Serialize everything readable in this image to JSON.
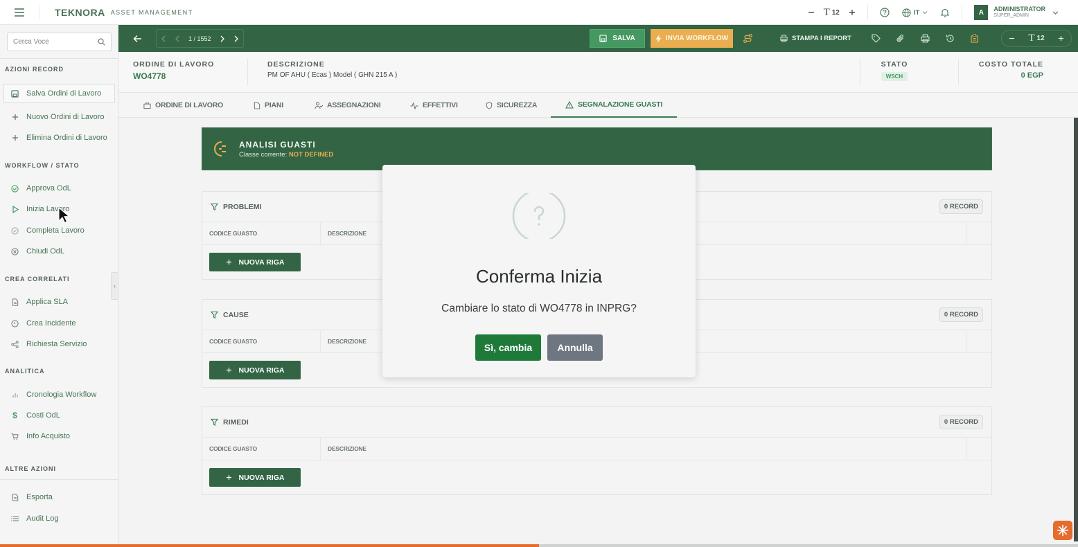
{
  "topbar": {
    "brand_logo": "TEKNORA",
    "brand_sub": "ASSET MANAGEMENT",
    "font_size_value": "12",
    "language": "IT",
    "avatar_initial": "A",
    "user_name": "ADMINISTRATOR",
    "user_role": "SUPER_ADMIN"
  },
  "sidebar": {
    "search_placeholder": "Cerca Voce",
    "section_record": "AZIONI RECORD",
    "save": "Salva Ordini di Lavoro",
    "new": "Nuovo Ordini di Lavoro",
    "delete": "Elimina Ordini di Lavoro",
    "section_workflow": "WORKFLOW / STATO",
    "approve": "Approva OdL",
    "start": "Inizia Lavoro",
    "complete": "Completa Lavoro",
    "close": "Chiudi OdL",
    "section_related": "CREA CORRELATI",
    "sla": "Applica SLA",
    "incident": "Crea Incidente",
    "service": "Richiesta Servizio",
    "section_analytics": "ANALITICA",
    "history": "Cronologia Workflow",
    "costs": "Costi OdL",
    "purchase": "Info Acquisto",
    "section_other": "ALTRE AZIONI",
    "export": "Esporta",
    "audit": "Audit Log"
  },
  "toolbar": {
    "pager_text": "1 / 1552",
    "save_label": "SALVA",
    "workflow_label": "INVIA WORKFLOW",
    "report_label": "STAMPA I REPORT",
    "font_size_value": "12"
  },
  "header": {
    "wo_label": "ORDINE DI LAVORO",
    "wo_value": "WO4778",
    "desc_label": "DESCRIZIONE",
    "desc_value": "PM OF AHU  ( Ecas ) Model ( GHN 215 A )",
    "status_label": "STATO",
    "status_value": "WSCH",
    "cost_label": "COSTO TOTALE",
    "cost_value": "0 EGP"
  },
  "tabs": [
    "ORDINE DI LAVORO",
    "PIANI",
    "ASSEGNAZIONI",
    "EFFETTIVI",
    "SICUREZZA",
    "SEGNALAZIONE GUASTI"
  ],
  "analysis": {
    "title": "ANALISI GUASTI",
    "class_label": "Classe corrente:",
    "class_value": "NOT DEFINED"
  },
  "panels": [
    {
      "title": "PROBLEMI",
      "records": "0 RECORD",
      "col1": "CODICE GUASTO",
      "col2": "DESCRIZIONE",
      "button": "NUOVA RIGA"
    },
    {
      "title": "CAUSE",
      "records": "0 RECORD",
      "col1": "CODICE GUASTO",
      "col2": "DESCRIZIONE",
      "button": "NUOVA RIGA"
    },
    {
      "title": "RIMEDI",
      "records": "0 RECORD",
      "col1": "CODICE GUASTO",
      "col2": "DESCRIZIONE",
      "button": "NUOVA RIGA"
    }
  ],
  "modal": {
    "title": "Conferma Inizia",
    "text": "Cambiare lo stato di WO4778 in INPRG?",
    "confirm": "Sì, cambia",
    "cancel": "Annulla"
  },
  "colors": {
    "primary": "#17502c",
    "accent": "#e8a33a",
    "orange": "#e46c2e"
  },
  "progress_fraction": 0.5
}
